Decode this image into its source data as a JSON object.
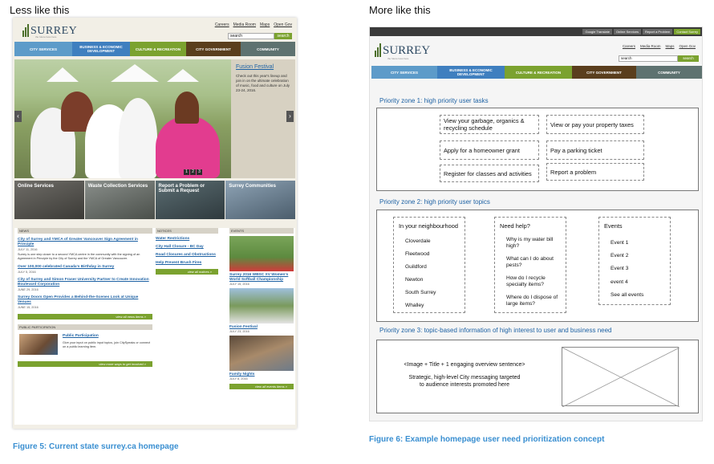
{
  "headings": {
    "left": "Less like this",
    "right": "More like this"
  },
  "captions": {
    "left": "Figure 5: Current state surrey.ca homepage",
    "right": "Figure 6: Example homepage user need prioritization concept"
  },
  "current_site": {
    "logo": {
      "wordmark": "SURREY",
      "tagline": "the future lives here."
    },
    "util_links": [
      "Careers",
      "Media Room",
      "Maps",
      "Open Gov"
    ],
    "search": {
      "value": "search",
      "button": "search"
    },
    "nav": [
      {
        "label": "CITY SERVICES",
        "color": "#5d9bc9"
      },
      {
        "label": "BUSINESS & ECONOMIC DEVELOPMENT",
        "color": "#3f7fbf"
      },
      {
        "label": "CULTURE & RECREATION",
        "color": "#7ba22f"
      },
      {
        "label": "CITY GOVERNMENT",
        "color": "#5a3e1d"
      },
      {
        "label": "COMMUNITY",
        "color": "#5e7270"
      }
    ],
    "feature": {
      "title": "Fusion Festival",
      "text": "Check out this year's lineup and join in on the ultimate celebration of music, food and culture on July 23-24, 2016.",
      "pager": [
        "1",
        "2",
        "3"
      ]
    },
    "tiles": [
      "Online Services",
      "Waste Collection Services",
      "Report a Problem or Submit a Request",
      "Surrey Communities"
    ],
    "news": {
      "header": "NEWS",
      "items": [
        {
          "title": "City of Surrey and YMCA of Greater Vancouver Sign Agreement in Principle",
          "date": "JULY 11, 2016",
          "text": "Surrey is one step closer to a second YMCA centre in the community with the signing of an Agreement in Principle by the City of Surrey and the YMCA of Greater Vancouver."
        },
        {
          "title": "Over 100,000 celebrated Canada's Birthday in Surrey",
          "date": "JULY 5, 2016",
          "text": ""
        },
        {
          "title": "City of Surrey and Simon Fraser University Partner to Create Innovation Boulevard Corporation",
          "date": "JUNE 29, 2016",
          "text": ""
        },
        {
          "title": "Surrey Doors Open Provides a Behind-the-Scenes Look at Unique Venues",
          "date": "JUNE 15, 2016",
          "text": ""
        }
      ],
      "more": "view all news items »"
    },
    "participation": {
      "header": "PUBLIC PARTICIPATION",
      "link": "Public Participation",
      "text": "Give your input on public input topics, join CitySpeaks or connect on a public learning item.",
      "more": "view more ways to get involved »"
    },
    "notices": {
      "header": "NOTICES",
      "items": [
        "Water Restrictions",
        "City Hall Closure - BC Day",
        "Road Closures and Obstructions",
        "Help Prevent Brush Fires"
      ],
      "more": "view all notices »"
    },
    "events": {
      "header": "EVENTS",
      "items": [
        {
          "title": "Surrey 2016 WBSC XV Women's World Softball Championship",
          "date": "JULY 15, 2016"
        },
        {
          "title": "Fusion Festival",
          "date": "JULY 23, 2016"
        },
        {
          "title": "Family Nights",
          "date": "JULY 8, 2016"
        }
      ],
      "more": "view all events items »"
    }
  },
  "concept_site": {
    "top_buttons": [
      "Google Translate",
      "Online Services",
      "Report a Problem",
      "Contact Surrey"
    ],
    "logo": {
      "wordmark": "SURREY",
      "tagline": "the future lives here."
    },
    "util_links": [
      "Careers",
      "Media Room",
      "Maps",
      "Open Gov"
    ],
    "search": {
      "value": "search",
      "button": "search"
    },
    "nav": [
      {
        "label": "CITY SERVICES",
        "color": "#5d9bc9"
      },
      {
        "label": "BUSINESS & ECONOMIC DEVELOPMENT",
        "color": "#3f7fbf"
      },
      {
        "label": "CULTURE & RECREATION",
        "color": "#7ba22f"
      },
      {
        "label": "CITY GOVERNMENT",
        "color": "#5a3e1d"
      },
      {
        "label": "COMMUNITY",
        "color": "#5e7270"
      }
    ],
    "zone1": {
      "title": "Priority zone 1: high priority user tasks",
      "tasks": [
        "View your garbage, organics & recycling schedule",
        "View or pay your property taxes",
        "Apply for a homeowner grant",
        "Pay a parking ticket",
        "Register for classes and activities",
        "Report a problem"
      ]
    },
    "zone2": {
      "title": "Priority zone 2: high priority user topics",
      "neighbourhood": {
        "header": "In your neighbourhood",
        "items": [
          "Cloverdale",
          "Fleetwood",
          "Guildford",
          "Newton",
          "South Surrey",
          "Whalley"
        ]
      },
      "help": {
        "header": "Need help?",
        "items": [
          "Why is my water bill high?",
          "What can I do about pests?",
          "How do I recycle specialty items?",
          "Where do I dispose of large items?"
        ]
      },
      "events": {
        "header": "Events",
        "items": [
          "Event 1",
          "Event 2",
          "Event 3",
          "event 4",
          "See all events"
        ]
      }
    },
    "zone3": {
      "title": "Priority zone 3: topic-based information of high interest to user and business need",
      "line1": "<Image + Title + 1 engaging overview sentence>",
      "line2": "Strategic, high-level City messaging targeted to audience interests promoted here"
    }
  }
}
